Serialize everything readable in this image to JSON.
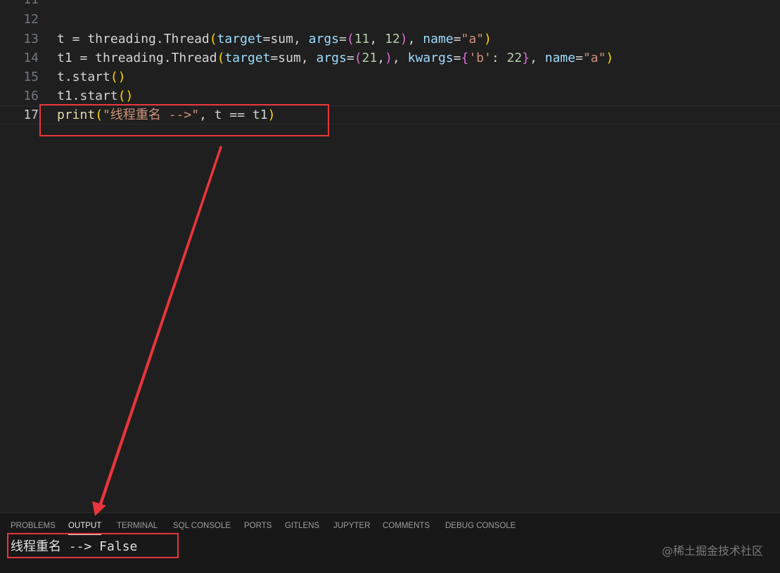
{
  "editor": {
    "lines": [
      {
        "number": "11",
        "tokens": []
      },
      {
        "number": "12",
        "tokens": []
      },
      {
        "number": "13",
        "tokens": [
          {
            "t": "t = threading.",
            "c": "def"
          },
          {
            "t": "Thread",
            "c": "def"
          },
          {
            "t": "(",
            "c": "br1"
          },
          {
            "t": "target",
            "c": "var"
          },
          {
            "t": "=sum, ",
            "c": "def"
          },
          {
            "t": "args",
            "c": "var"
          },
          {
            "t": "=",
            "c": "def"
          },
          {
            "t": "(",
            "c": "br2"
          },
          {
            "t": "11",
            "c": "num"
          },
          {
            "t": ", ",
            "c": "def"
          },
          {
            "t": "12",
            "c": "num"
          },
          {
            "t": ")",
            "c": "br2"
          },
          {
            "t": ", ",
            "c": "def"
          },
          {
            "t": "name",
            "c": "var"
          },
          {
            "t": "=",
            "c": "def"
          },
          {
            "t": "\"a\"",
            "c": "str"
          },
          {
            "t": ")",
            "c": "br1"
          }
        ]
      },
      {
        "number": "14",
        "tokens": [
          {
            "t": "t1 = threading.",
            "c": "def"
          },
          {
            "t": "Thread",
            "c": "def"
          },
          {
            "t": "(",
            "c": "br1"
          },
          {
            "t": "target",
            "c": "var"
          },
          {
            "t": "=sum, ",
            "c": "def"
          },
          {
            "t": "args",
            "c": "var"
          },
          {
            "t": "=",
            "c": "def"
          },
          {
            "t": "(",
            "c": "br2"
          },
          {
            "t": "21",
            "c": "num"
          },
          {
            "t": ",",
            "c": "def"
          },
          {
            "t": ")",
            "c": "br2"
          },
          {
            "t": ", ",
            "c": "def"
          },
          {
            "t": "kwargs",
            "c": "var"
          },
          {
            "t": "=",
            "c": "def"
          },
          {
            "t": "{",
            "c": "br2"
          },
          {
            "t": "'b'",
            "c": "str"
          },
          {
            "t": ": ",
            "c": "def"
          },
          {
            "t": "22",
            "c": "num"
          },
          {
            "t": "}",
            "c": "br2"
          },
          {
            "t": ", ",
            "c": "def"
          },
          {
            "t": "name",
            "c": "var"
          },
          {
            "t": "=",
            "c": "def"
          },
          {
            "t": "\"a\"",
            "c": "str"
          },
          {
            "t": ")",
            "c": "br1"
          }
        ]
      },
      {
        "number": "15",
        "tokens": [
          {
            "t": "t.start",
            "c": "def"
          },
          {
            "t": "()",
            "c": "br1"
          }
        ]
      },
      {
        "number": "16",
        "tokens": [
          {
            "t": "t1.start",
            "c": "def"
          },
          {
            "t": "()",
            "c": "br1"
          }
        ]
      },
      {
        "number": "17",
        "current": true,
        "tokens": [
          {
            "t": "print",
            "c": "fn"
          },
          {
            "t": "(",
            "c": "br1"
          },
          {
            "t": "\"线程重名 -->\"",
            "c": "str"
          },
          {
            "t": ", t == t1",
            "c": "def"
          },
          {
            "t": ")",
            "c": "br1"
          }
        ]
      }
    ]
  },
  "panel": {
    "tabs": [
      {
        "label": "PROBLEMS",
        "active": false
      },
      {
        "label": "OUTPUT",
        "active": true
      },
      {
        "label": "TERMINAL",
        "active": false
      },
      {
        "label": "SQL CONSOLE",
        "active": false
      },
      {
        "label": "PORTS",
        "active": false
      },
      {
        "label": "GITLENS",
        "active": false
      },
      {
        "label": "JUPYTER",
        "active": false
      },
      {
        "label": "COMMENTS",
        "active": false
      },
      {
        "label": "DEBUG CONSOLE",
        "active": false
      }
    ],
    "output": "线程重名 --> False"
  },
  "watermark": "@稀土掘金技术社区",
  "colors": {
    "annotation": "#e8353b",
    "editor_bg": "#1f1f1f",
    "panel_bg": "#181818"
  }
}
